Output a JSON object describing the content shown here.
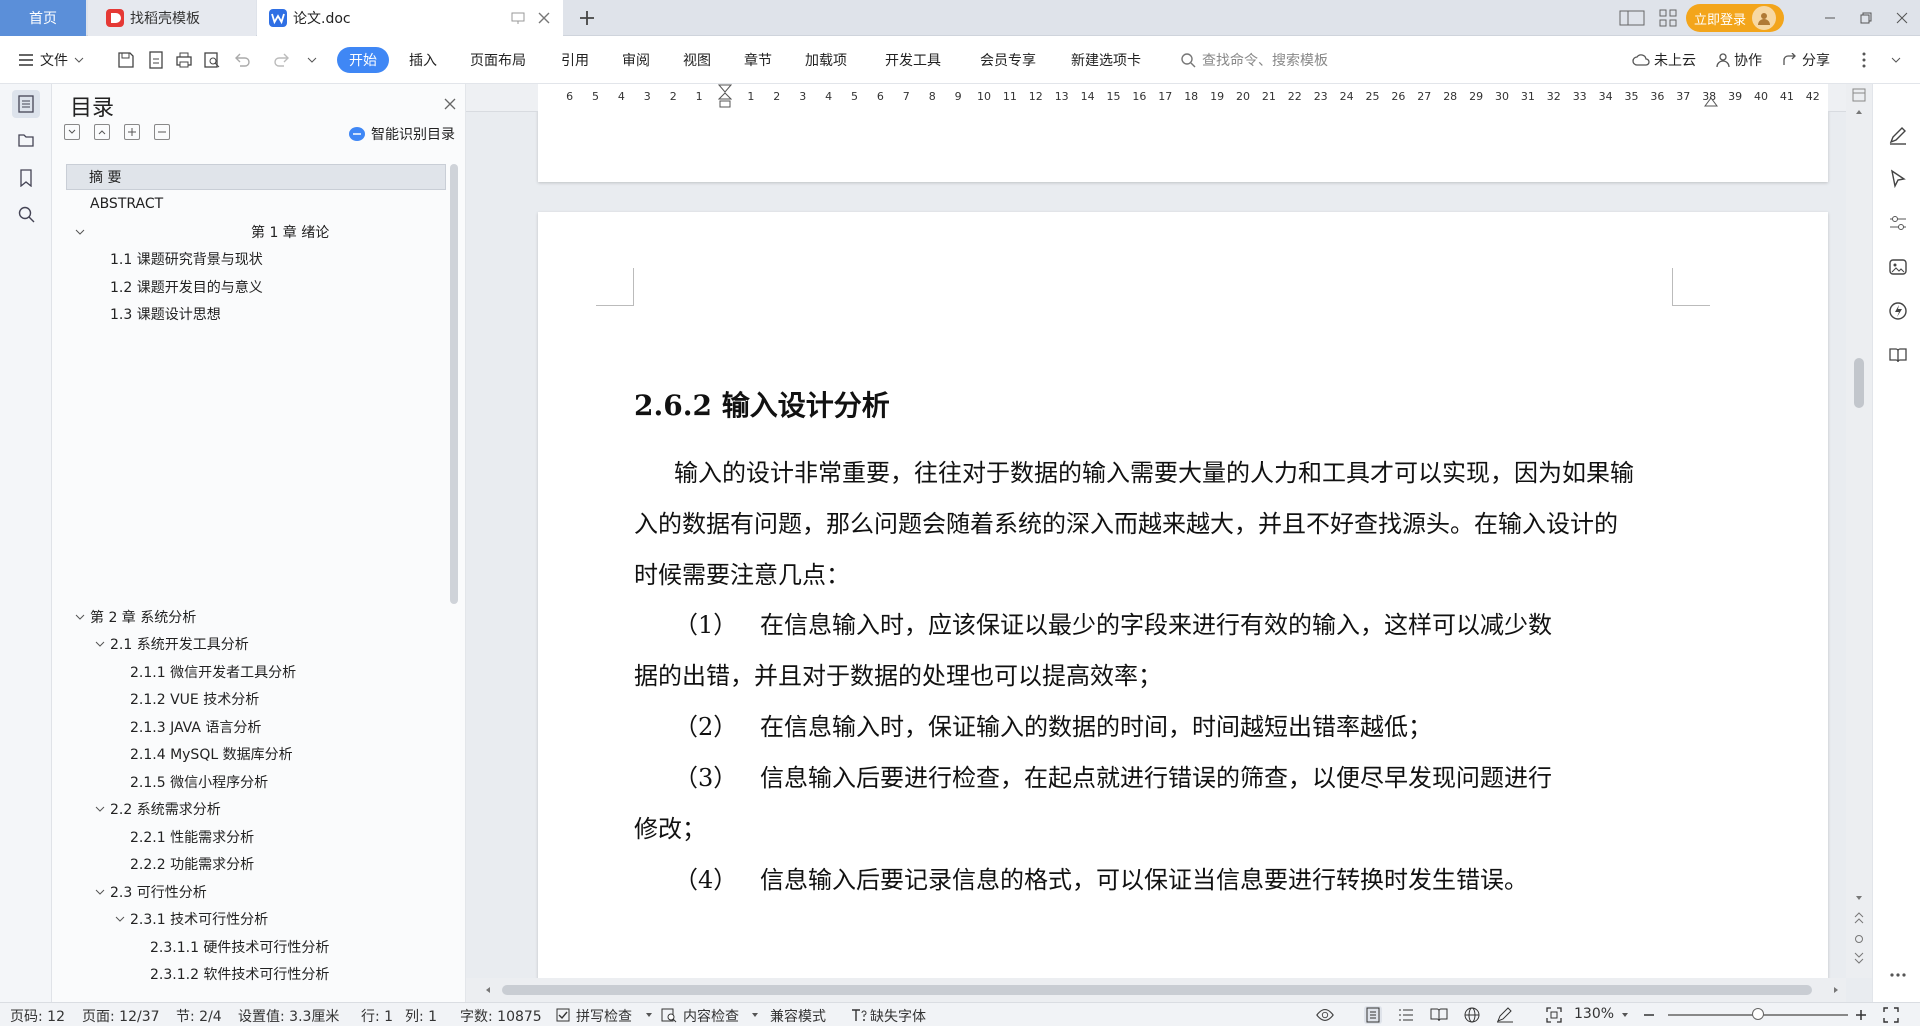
{
  "tabs": {
    "home": "首页",
    "template": "找稻壳模板",
    "doc": "论文.doc"
  },
  "account": {
    "login": "立即登录"
  },
  "ribbon": {
    "file": "文件",
    "tabs": [
      "开始",
      "插入",
      "页面布局",
      "引用",
      "审阅",
      "视图",
      "章节",
      "加载项",
      "开发工具",
      "会员专享",
      "新建选项卡"
    ],
    "search_placeholder": "查找命令、搜索模板",
    "cloud": "未上云",
    "collab": "协作",
    "share": "分享"
  },
  "toc": {
    "title": "目录",
    "smart": "智能识别目录",
    "items": [
      {
        "label": "摘  要"
      },
      {
        "label": "ABSTRACT"
      },
      {
        "label": "第 1 章  绪论"
      },
      {
        "label": "1.1  课题研究背景与现状"
      },
      {
        "label": "1.2 课题开发目的与意义"
      },
      {
        "label": "1.3  课题设计思想"
      },
      {
        "label": "第 2 章  系统分析"
      },
      {
        "label": "2.1  系统开发工具分析"
      },
      {
        "label": "2.1.1  微信开发者工具分析"
      },
      {
        "label": "2.1.2  VUE 技术分析"
      },
      {
        "label": "2.1.3  JAVA 语言分析"
      },
      {
        "label": "2.1.4  MySQL 数据库分析"
      },
      {
        "label": "2.1.5  微信小程序分析"
      },
      {
        "label": "2.2 系统需求分析"
      },
      {
        "label": "2.2.1  性能需求分析"
      },
      {
        "label": "2.2.2  功能需求分析"
      },
      {
        "label": "2.3 可行性分析"
      },
      {
        "label": "2.3.1  技术可行性分析"
      },
      {
        "label": "2.3.1.1 硬件技术可行性分析"
      },
      {
        "label": "2.3.1.2 软件技术可行性分析"
      }
    ]
  },
  "ruler": {
    "left": [
      "6",
      "5",
      "4",
      "3",
      "2",
      "1"
    ],
    "right": [
      "1",
      "2",
      "3",
      "4",
      "5",
      "6",
      "7",
      "8",
      "9",
      "10",
      "11",
      "12",
      "13",
      "14",
      "15",
      "16",
      "17",
      "18",
      "19",
      "20",
      "21",
      "22",
      "23",
      "24",
      "25",
      "26",
      "27",
      "28",
      "29",
      "30",
      "31",
      "32",
      "33",
      "34",
      "35",
      "36",
      "37",
      "38",
      "39",
      "40",
      "41",
      "42"
    ]
  },
  "document": {
    "heading": "2.6.2 输入设计分析",
    "para1": "输入的设计非常重要，往往对于数据的输入需要大量的人力和工具才可以实现，因为如果输入的数据有问题，那么问题会随着系统的深入而越来越大，并且不好查找源头。在输入设计的时候需要注意几点：",
    "items": [
      {
        "num": "（1）",
        "text": "在信息输入时，应该保证以最少的字段来进行有效的输入，这样可以减少数",
        "cont": "据的出错，并且对于数据的处理也可以提高效率；"
      },
      {
        "num": "（2）",
        "text": "在信息输入时，保证输入的数据的时间，时间越短出错率越低；",
        "cont": ""
      },
      {
        "num": "（3）",
        "text": "信息输入后要进行检查，在起点就进行错误的筛查，以便尽早发现问题进行",
        "cont": "修改；"
      },
      {
        "num": "（4）",
        "text": "信息输入后要记录信息的格式，可以保证当信息要进行转换时发生错误。",
        "cont": ""
      }
    ]
  },
  "status": {
    "page_num": "页码: 12",
    "page": "页面: 12/37",
    "section": "节: 2/4",
    "setting": "设置值: 3.3厘米",
    "row": "行: 1",
    "col": "列: 1",
    "words": "字数: 10875",
    "spell": "拼写检查",
    "content_check": "内容检查",
    "compat": "兼容模式",
    "missing_font": "缺失字体",
    "zoom": "130%"
  }
}
